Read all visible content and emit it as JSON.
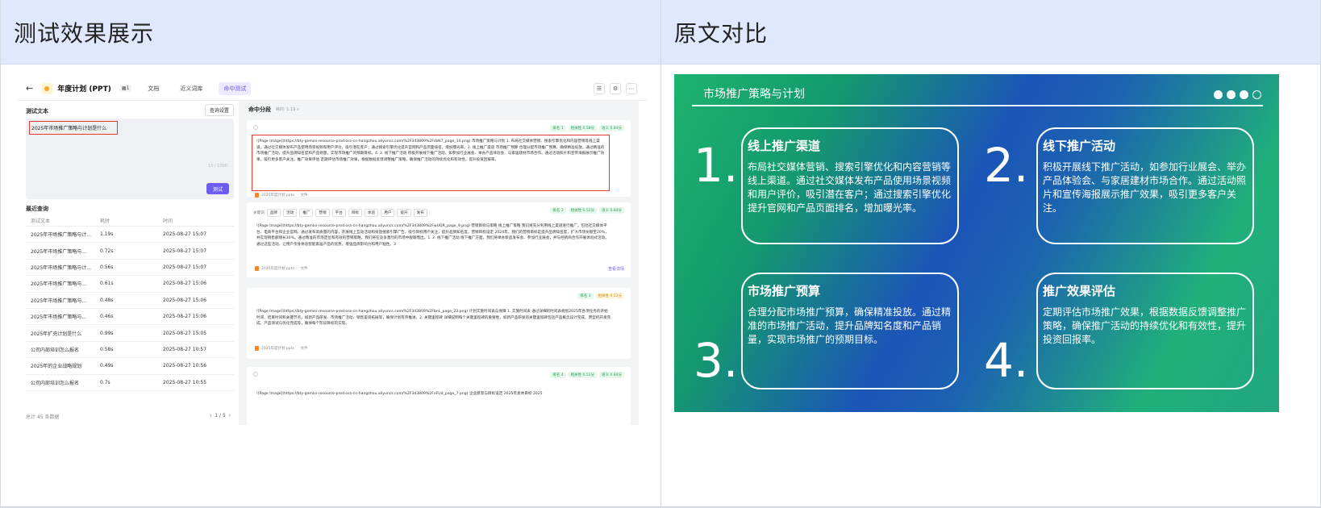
{
  "left_panel": {
    "title": "测试效果展示"
  },
  "right_panel": {
    "title": "原文对比"
  },
  "app": {
    "doc_title": "年度计划 (PPT)",
    "doc_count": "1",
    "tabs": [
      "文档",
      "近义词库",
      "命中测试"
    ],
    "active_tab": "命中测试",
    "left": {
      "section_title": "测试文本",
      "settings_button": "查询设置",
      "query_text": "2025年市场推广策略与计划是什么",
      "char_count": "15 / 1000",
      "test_button": "测试",
      "recent_title": "最近查询",
      "columns": [
        "测试文本",
        "耗时",
        "时间"
      ],
      "rows": [
        [
          "2025年市场推广策略与计...",
          "1.19s",
          "2025-08-27 15:07"
        ],
        [
          "2025年市场推广策略与...",
          "0.72s",
          "2025-08-27 15:07"
        ],
        [
          "2025年市场推广策略与计...",
          "0.56s",
          "2025-08-27 15:07"
        ],
        [
          "2025年市场推广策略与...",
          "0.61s",
          "2025-08-27 15:06"
        ],
        [
          "2025年市场推广策略与...",
          "0.48s",
          "2025-08-27 15:06"
        ],
        [
          "2025年市场推广策略与...",
          "0.46s",
          "2025-08-27 15:06"
        ],
        [
          "2025年扩充计划是什么",
          "0.99s",
          "2025-08-27 15:05"
        ],
        [
          "公司内部培训怎么报名",
          "0.58s",
          "2025-08-27 10:57"
        ],
        [
          "2025年的企业战略规划",
          "0.49s",
          "2025-08-27 10:56"
        ],
        [
          "公司内部培训怎么报名",
          "0.7s",
          "2025-08-27 10:55"
        ]
      ],
      "total": "总计 45 条数据",
      "page": "1 / 5"
    },
    "right": {
      "section_title": "命中分段",
      "elapsed": "耗时: 1.19 s",
      "file_label": "2025年度计划.pptx",
      "file_suffix": "文件",
      "detail_link": "查看详情",
      "keywords_label": "关键词",
      "keywords": [
        "品牌",
        "活动",
        "推广",
        "营销",
        "平台",
        "目标",
        "体验",
        "用户",
        "提升",
        "发布"
      ],
      "cards": [
        {
          "tags": [
            "排名 1",
            "相关性 0.58分",
            "语义 0.84分"
          ],
          "text": "![Page Image](https://bty-gemini-resource-prod.oss-cn-hangzhou.aliyuncs.com/%2F343809%2FdsN7_page_14.png) 市场推广策略与计划 1. 布局社交媒体营销、搜索引擎优化和内容营销等线上渠道。通过社交媒体发布产品使用场景视频和用户评价，吸引潜在客户；通过搜索引擎优化提升官网和产品页面排名，增加曝光率。2. 线上推广渠道 市场推广预算 合理分配市场推广预算，确保精准投放。通过精准的市场推广活动，提升品牌知名度和产品销量，实现市场推广的预期目标。4. 3. 线下推广活动 积极开展线下推广活动，如参加行业展会、举办产品体验会、与家居建材市场合作。通过活动照片和宣传海报展示推广效果，吸引更多客户关注。推广效果评估 定期评估市场推广效果，根据数据反馈调整推广策略，确保推广活动的持续优化和有效性，提升投资回报率。"
        },
        {
          "tags": [
            "排名 2",
            "相关性 0.52分",
            "语义 0.84分"
          ],
          "text": "![Page Image](https://bty-gemini-resource-prod.oss-cn-hangzhou.aliyuncs.com/%2F343809%2FwUQR_page_9.png) 营销目标与策略 线上推广策略 我们将充分利用线上渠道进行推广，包括社交媒体平台、电商平台和企业官网。通过发布高质量的内容，开展线上互动活动和投放搜索引擎广告，吸引目标用户关注，提升品牌知名度。营销目标设定 2024年，我们的营销目标是提升品牌知名度，扩大市场份额至20%，并实现销售额增长30%。通过精准的市场定位和有效的营销策略，我们将在竞争激烈的市场中脱颖而出。1. 2. 线下推广活动 线下推广方面，我们将举办新品发布会、参加行业展会，并与经销商合作开展体验式活动。通过这些活动，让用户亲身体验智能家居产品的优势，增强品牌影响力和用户粘性。3"
        },
        {
          "tags": [
            "排名 3",
            "相关性 0.52分"
          ],
          "text": "![Page Image](https://bty-gemini-resource-prod.oss-cn-hangzhou.aliyuncs.com/%2F343809%2FbnL_page_23.png) 计划实施时间表与保障 1. 实施时间表 通过详细的时间表规划2025年各项任务的开始时间、结束时间和关键节点，如新产品研发、市场推广活动、销售渠道拓展等，确保计划有序推进。2. 关键里程碑 详细说明每个关键里程碑的重要性，如新产品研发的关键里程碑包括产品概念设计完成、原型机开发完成、产品测试与优化完成等，确保每个阶段目标的实现。"
        },
        {
          "tags": [
            "排名 4",
            "相关性 0.51分",
            "语义 0.84分"
          ],
          "text": "![Page Image](https://bty-gemini-resource-prod.oss-cn-hangzhou.aliyuncs.com/%2F343809%2FxFUd_page_7.png) 企业愿景与目标设定 2025年具体目标 2025"
        }
      ]
    }
  },
  "slide": {
    "title": "市场推广策略与计划",
    "items": [
      {
        "num": "1.",
        "title": "线上推广渠道",
        "body": "布局社交媒体营销、搜索引擎优化和内容营销等线上渠道。通过社交媒体发布产品使用场景视频和用户评价，吸引潜在客户；通过搜索引擎优化提升官网和产品页面排名，增加曝光率。"
      },
      {
        "num": "2.",
        "title": "线下推广活动",
        "body": "积极开展线下推广活动，如参加行业展会、举办产品体验会、与家居建材市场合作。通过活动照片和宣传海报展示推广效果，吸引更多客户关注。"
      },
      {
        "num": "3.",
        "title": "市场推广预算",
        "body": "合理分配市场推广预算，确保精准投放。通过精准的市场推广活动，提升品牌知名度和产品销量，实现市场推广的预期目标。"
      },
      {
        "num": "4.",
        "title": "推广效果评估",
        "body": "定期评估市场推广效果，根据数据反馈调整推广策略，确保推广活动的持续优化和有效性，提升投资回报率。"
      }
    ]
  }
}
